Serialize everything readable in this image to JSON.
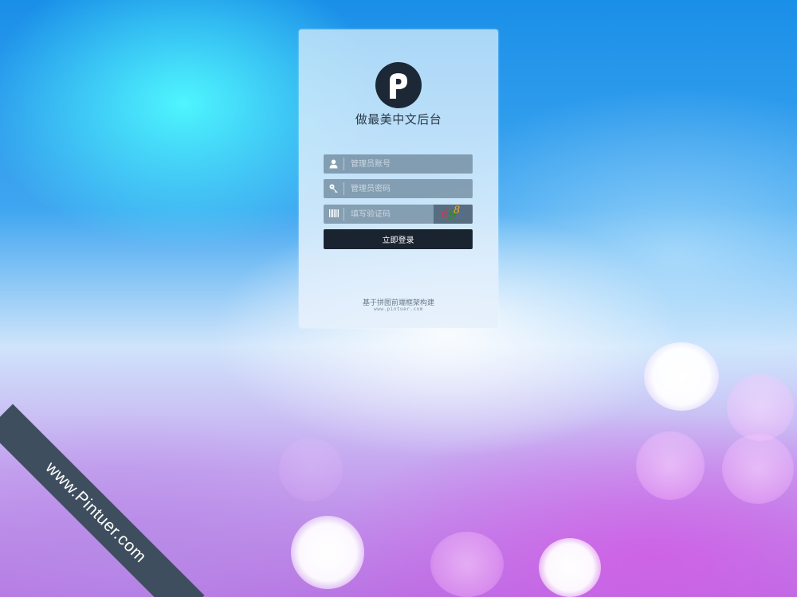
{
  "panel": {
    "logo_letter": "p",
    "title": "做最美中文后台"
  },
  "form": {
    "username_placeholder": "管理员账号",
    "password_placeholder": "管理员密码",
    "captcha_placeholder": "填写验证码",
    "captcha_chars": [
      {
        "char": "6",
        "color": "#d8344a"
      },
      {
        "char": "9",
        "color": "#2c8a3a"
      },
      {
        "char": "8",
        "color": "#e8aa30"
      },
      {
        "char": "2",
        "color": "#4a6fb8"
      }
    ],
    "submit_label": "立即登录"
  },
  "footer": {
    "text": "基于拼图前端框架构建",
    "url": "www.pintuer.com"
  },
  "ribbon": {
    "text": "www.Pintuer.com"
  },
  "icons": {
    "username": "user-icon",
    "password": "key-icon",
    "captcha": "barcode-icon"
  }
}
